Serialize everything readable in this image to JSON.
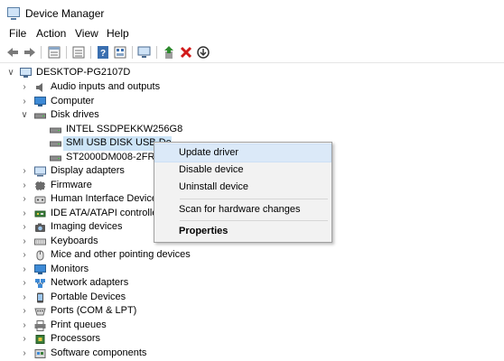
{
  "window": {
    "title": "Device Manager"
  },
  "menu": [
    "File",
    "Action",
    "View",
    "Help"
  ],
  "toolbar": {
    "icons": [
      "back-arrow-icon",
      "forward-arrow-icon",
      "properties-icon",
      "view-icon",
      "help-icon",
      "resources-icon",
      "scan-computer-icon",
      "update-driver-icon",
      "uninstall-icon",
      "disable-icon"
    ],
    "colors": {
      "update": "#2d8a2d",
      "uninstall": "#d11a1a"
    }
  },
  "tree": {
    "root": "DESKTOP-PG2107D",
    "categories": [
      "Audio inputs and outputs",
      "Computer",
      "Disk drives",
      "Display adapters",
      "Firmware",
      "Human Interface Devices",
      "IDE ATA/ATAPI controllers",
      "Imaging devices",
      "Keyboards",
      "Mice and other pointing devices",
      "Monitors",
      "Network adapters",
      "Portable Devices",
      "Ports (COM & LPT)",
      "Print queues",
      "Processors",
      "Software components"
    ],
    "disk_children": [
      "INTEL SSDPEKKW256G8",
      "SMI USB DISK USB De",
      "ST2000DM008-2FR10"
    ]
  },
  "context_menu": {
    "items": [
      "Update driver",
      "Disable device",
      "Uninstall device",
      "Scan for hardware changes",
      "Properties"
    ],
    "highlight_color": "#dbe9f8"
  },
  "selection_color": "#cce4f7"
}
